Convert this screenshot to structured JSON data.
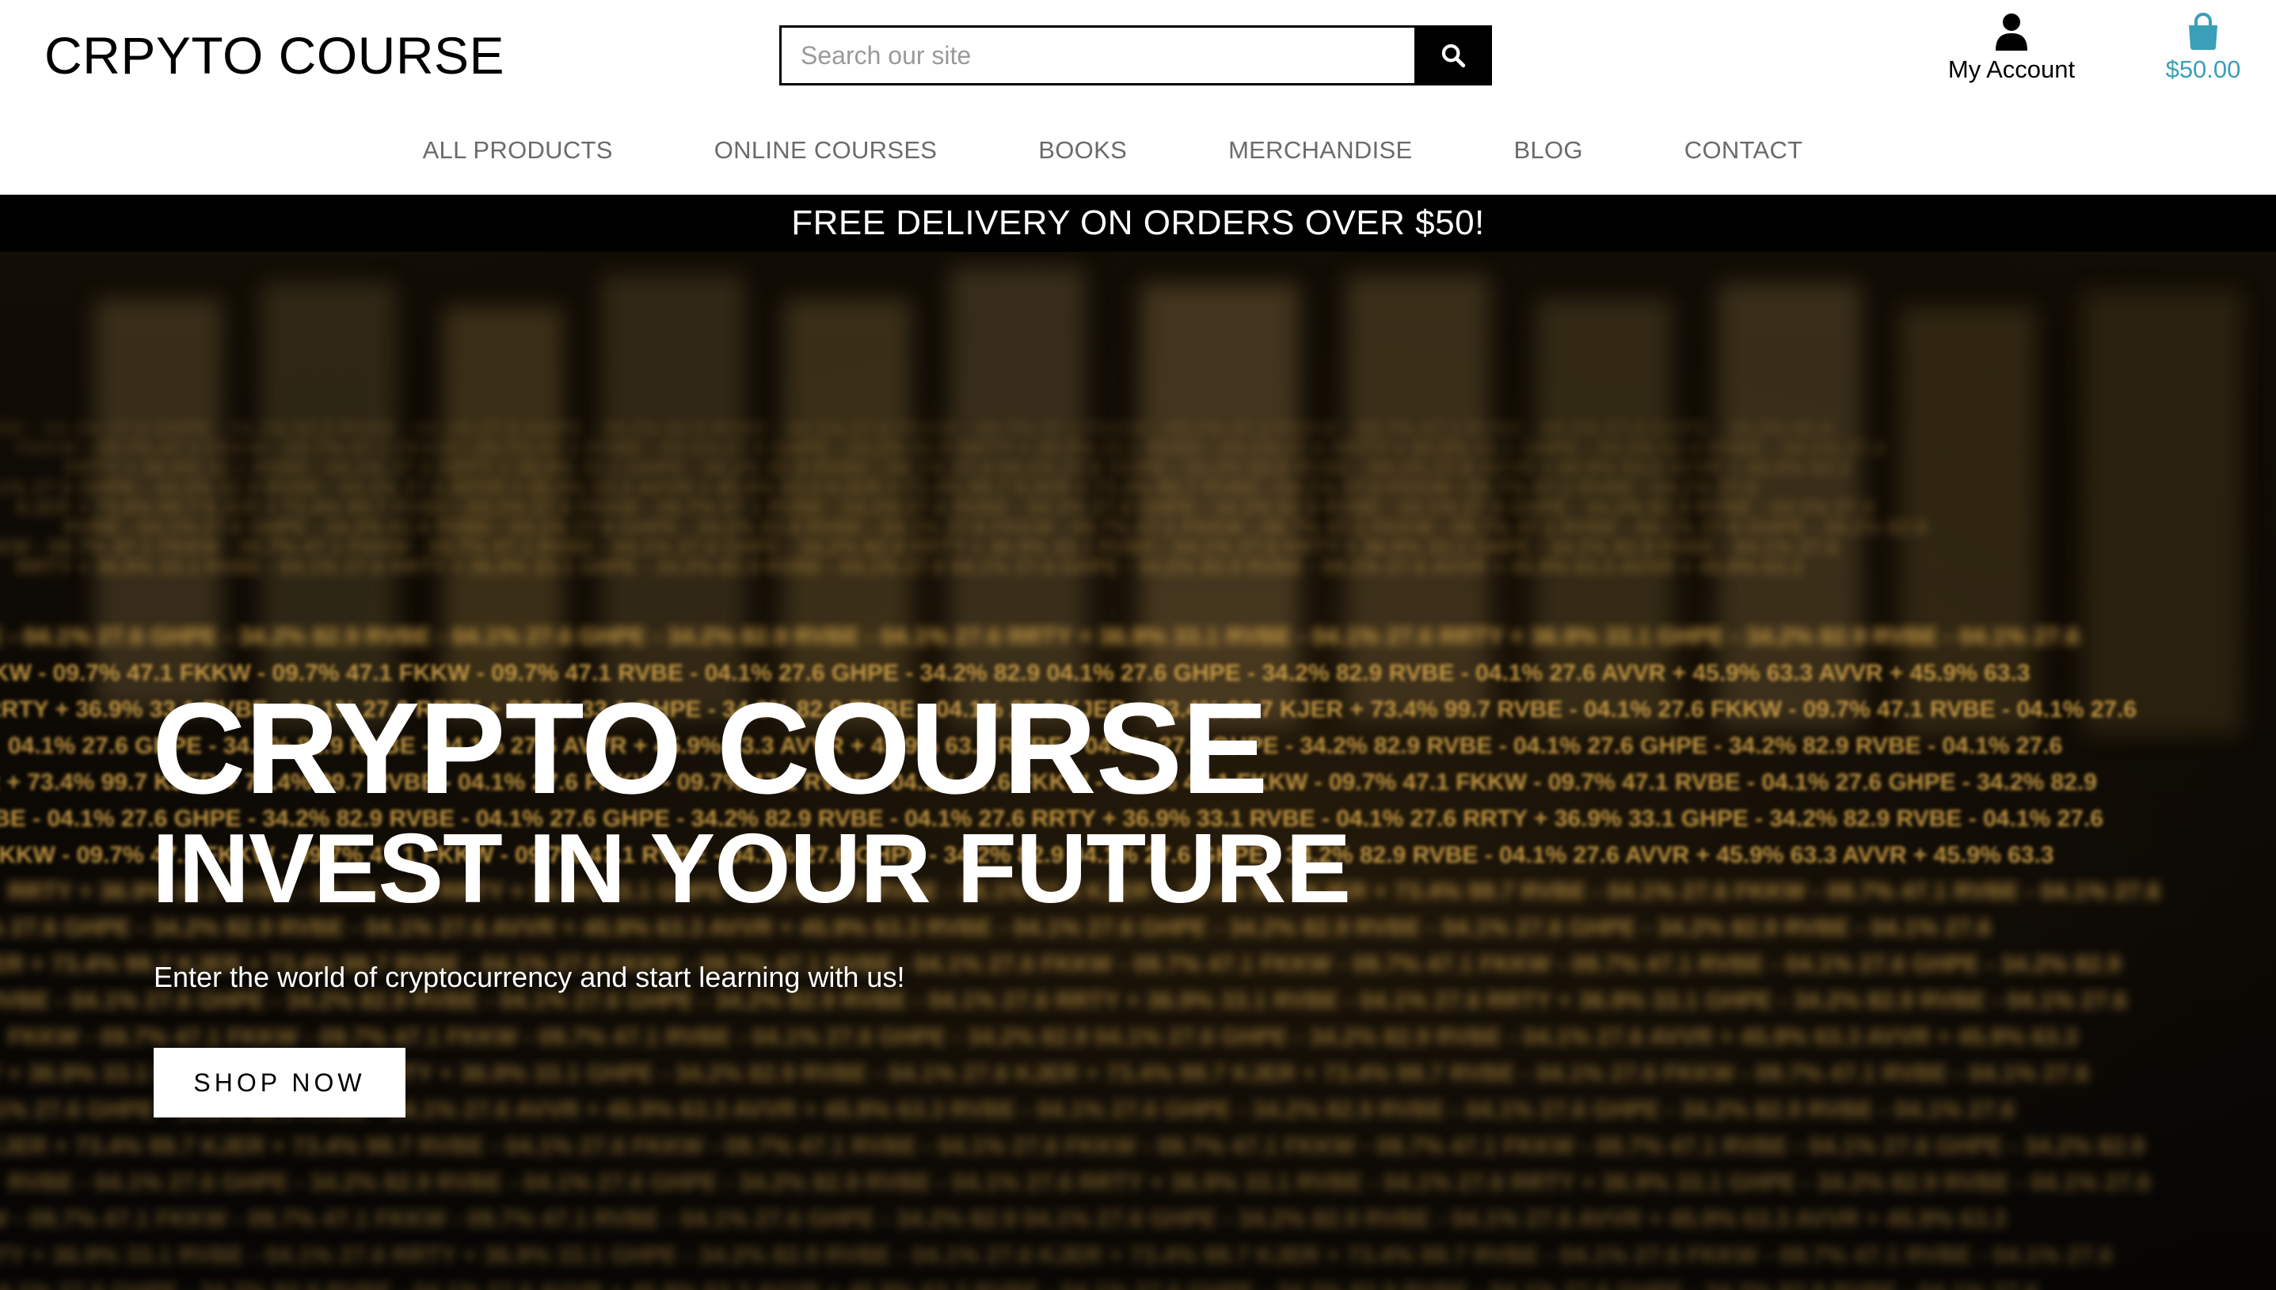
{
  "header": {
    "logo": "CRPYTO COURSE",
    "search": {
      "placeholder": "Search our site",
      "value": ""
    },
    "account_label": "My Account",
    "bag_total": "$50.00"
  },
  "nav": {
    "items": [
      {
        "label": "ALL PRODUCTS"
      },
      {
        "label": "ONLINE COURSES"
      },
      {
        "label": "BOOKS"
      },
      {
        "label": "MERCHANDISE"
      },
      {
        "label": "BLOG"
      },
      {
        "label": "CONTACT"
      }
    ]
  },
  "banner": {
    "text": "FREE DELIVERY ON ORDERS OVER $50!"
  },
  "hero": {
    "title": "CRYPTO COURSE",
    "subtitle": "INVEST IN YOUR FUTURE",
    "description": "Enter the world of cryptocurrency and start learning with us!",
    "cta_label": "SHOP NOW",
    "ticker_rows": [
      "RVBE - 04.1% 27.6   GHPE - 34.2% 82.9   RVBE - 04.1% 27.6   GHPE - 34.2% 82.9   RVBE - 04.1% 27.6",
      "FKKW - 09.7% 47.1   FKKW - 09.7% 47.1   FKKW - 09.7% 47.1   RVBE - 04.1% 27.6   GHPE - 34.2% 82.9",
      "RRTY + 36.9% 33.1   RVBE - 04.1% 27.6   RRTY + 36.9% 33.1   GHPE - 34.2% 82.9   RVBE - 04.1% 27.6",
      "04.1% 27.6   GHPE - 34.2% 82.9   RVBE - 04.1% 27.6   AVVR + 45.9% 63.3   AVVR + 45.9% 63.3",
      "KJER + 73.4% 99.7   KJER + 73.4% 99.7   RVBE - 04.1% 27.6   FKKW - 09.7% 47.1   RVBE - 04.1% 27.6"
    ]
  },
  "colors": {
    "accent": "#3a9fb8",
    "nav_text": "#6b6b6b",
    "banner_bg": "#000000",
    "ticker_gold": "#d9a84a"
  }
}
